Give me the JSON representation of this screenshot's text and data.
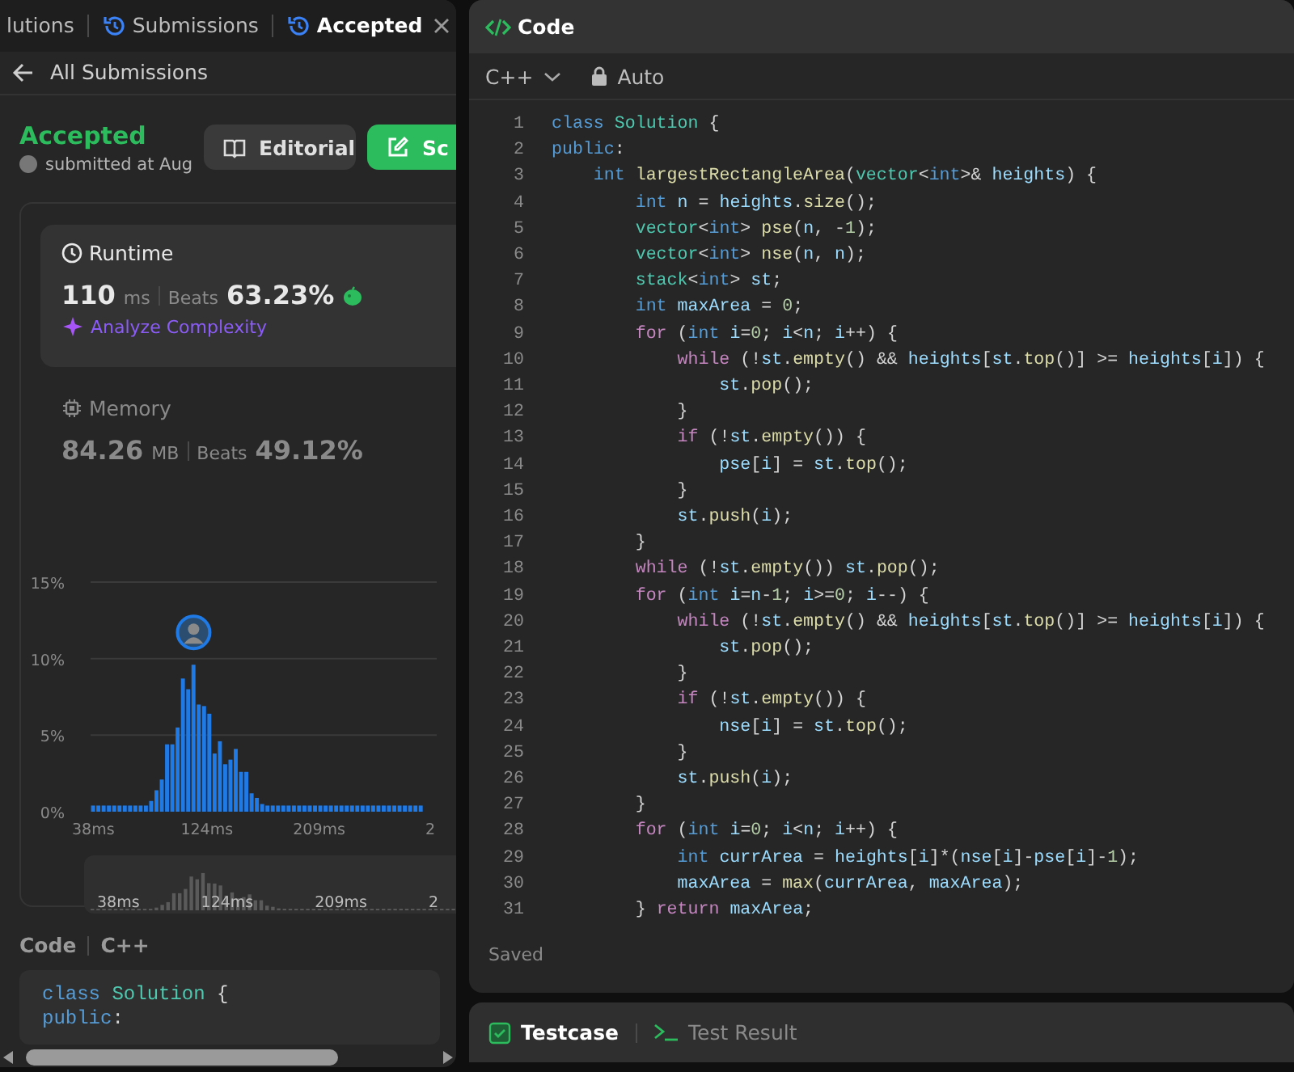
{
  "left_panel": {
    "tabs": [
      {
        "label": "lutions",
        "kind": "plain",
        "selected": false,
        "closable": false
      },
      {
        "label": "Submissions",
        "kind": "history",
        "selected": false,
        "closable": false
      },
      {
        "label": "Accepted",
        "kind": "history",
        "selected": true,
        "closable": true
      }
    ],
    "back_link": "All Submissions",
    "result": {
      "status": "Accepted",
      "submitted": "submitted at Aug"
    },
    "buttons": [
      {
        "label": "Editorial",
        "kind": "secondary"
      },
      {
        "label": "Sc",
        "kind": "primary"
      }
    ],
    "stats": [
      {
        "kind": "runtime",
        "title": "Runtime",
        "value": "110",
        "unit": "ms",
        "beats_label": "Beats",
        "beats": "63.23%",
        "selected": true,
        "link": "Analyze Complexity"
      },
      {
        "kind": "memory",
        "title": "Memory",
        "value": "84.26",
        "unit": "MB",
        "beats_label": "Beats",
        "beats": "49.12%",
        "selected": false
      }
    ],
    "chart_data": {
      "type": "bar",
      "xlim": [
        36,
        298
      ],
      "ylim": [
        0,
        15
      ],
      "yticks": [
        {
          "value": 0,
          "label": "0%"
        },
        {
          "value": 5,
          "label": "5%"
        },
        {
          "value": 10,
          "label": "10%"
        },
        {
          "value": 15,
          "label": "15%"
        }
      ],
      "xticks": [
        {
          "value": 38,
          "label": "38ms"
        },
        {
          "value": 124,
          "label": "124ms"
        },
        {
          "value": 209,
          "label": "209ms"
        }
      ],
      "x": [
        38,
        42,
        46,
        50,
        54,
        58,
        62,
        66,
        70,
        74,
        78,
        82,
        86,
        90,
        94,
        98,
        102,
        106,
        110,
        114,
        118,
        122,
        126,
        130,
        134,
        138,
        142,
        146,
        150,
        154,
        158,
        162,
        166,
        170,
        174,
        178,
        182,
        186,
        190,
        194,
        198,
        202,
        206,
        210,
        214,
        218,
        222,
        226,
        230,
        234,
        238,
        242,
        246,
        250,
        254,
        258,
        262,
        266,
        270,
        274,
        278,
        282,
        286
      ],
      "series": [
        {
          "color": "#1f7ae6",
          "values": [
            0.4,
            0.4,
            0.4,
            0.4,
            0.4,
            0.4,
            0.4,
            0.4,
            0.4,
            0.4,
            0.4,
            0.7,
            1.4,
            2.1,
            4.4,
            4.4,
            5.5,
            8.7,
            8.0,
            9.6,
            7.0,
            6.9,
            6.4,
            3.8,
            4.6,
            3.1,
            3.4,
            4.1,
            2.6,
            2.6,
            1.2,
            0.9,
            0.5,
            0.4,
            0.4,
            0.4,
            0.4,
            0.4,
            0.4,
            0.4,
            0.4,
            0.4,
            0.4,
            0.4,
            0.4,
            0.4,
            0.4,
            0.4,
            0.4,
            0.4,
            0.4,
            0.4,
            0.4,
            0.4,
            0.4,
            0.4,
            0.4,
            0.4,
            0.4,
            0.4,
            0.4,
            0.4,
            0.4
          ]
        }
      ]
    },
    "chart_edge_label": "2",
    "overview_labels": [
      "38ms",
      "124ms",
      "209ms",
      "2"
    ],
    "code_header": {
      "title": "Code",
      "language": "C++"
    },
    "code_preview": [
      "class Solution {",
      "public:"
    ]
  },
  "editor": {
    "title": "Code",
    "language": "C++",
    "mode": "Auto",
    "lines": [
      {
        "num": "1",
        "text": "class Solution {"
      },
      {
        "num": "2",
        "text": "public:"
      },
      {
        "num": "3",
        "text": "    int largestRectangleArea(vector<int>& heights) {"
      },
      {
        "num": "4",
        "text": "        int n = heights.size();"
      },
      {
        "num": "5",
        "text": "        vector<int> pse(n, -1);"
      },
      {
        "num": "6",
        "text": "        vector<int> nse(n, n);"
      },
      {
        "num": "7",
        "text": "        stack<int> st;"
      },
      {
        "num": "8",
        "text": "        int maxArea = 0;"
      },
      {
        "num": "9",
        "text": "        for (int i=0; i<n; i++) {"
      },
      {
        "num": "10",
        "text": "            while (!st.empty() && heights[st.top()] >= heights[i]) {"
      },
      {
        "num": "11",
        "text": "                st.pop();"
      },
      {
        "num": "12",
        "text": "            }"
      },
      {
        "num": "13",
        "text": "            if (!st.empty()) {"
      },
      {
        "num": "14",
        "text": "                pse[i] = st.top();"
      },
      {
        "num": "15",
        "text": "            }"
      },
      {
        "num": "16",
        "text": "            st.push(i);"
      },
      {
        "num": "17",
        "text": "        }"
      },
      {
        "num": "18",
        "text": "        while (!st.empty()) st.pop();"
      },
      {
        "num": "19",
        "text": "        for (int i=n-1; i>=0; i--) {"
      },
      {
        "num": "20",
        "text": "            while (!st.empty() && heights[st.top()] >= heights[i]) {"
      },
      {
        "num": "21",
        "text": "                st.pop();"
      },
      {
        "num": "22",
        "text": "            }"
      },
      {
        "num": "23",
        "text": "            if (!st.empty()) {"
      },
      {
        "num": "24",
        "text": "                nse[i] = st.top();"
      },
      {
        "num": "25",
        "text": "            }"
      },
      {
        "num": "26",
        "text": "            st.push(i);"
      },
      {
        "num": "27",
        "text": "        }"
      },
      {
        "num": "28",
        "text": "        for (int i=0; i<n; i++) {"
      },
      {
        "num": "29",
        "text": "            int currArea = heights[i]*(nse[i]-pse[i]-1);"
      },
      {
        "num": "30",
        "text": "            maxArea = max(currArea, maxArea);"
      },
      {
        "num": "31",
        "text": "        } return maxArea;"
      }
    ],
    "status": "Saved"
  },
  "bottom_tabs": [
    {
      "label": "Testcase",
      "kind": "testcase",
      "selected": true
    },
    {
      "label": "Test Result",
      "kind": "result",
      "selected": false
    }
  ]
}
